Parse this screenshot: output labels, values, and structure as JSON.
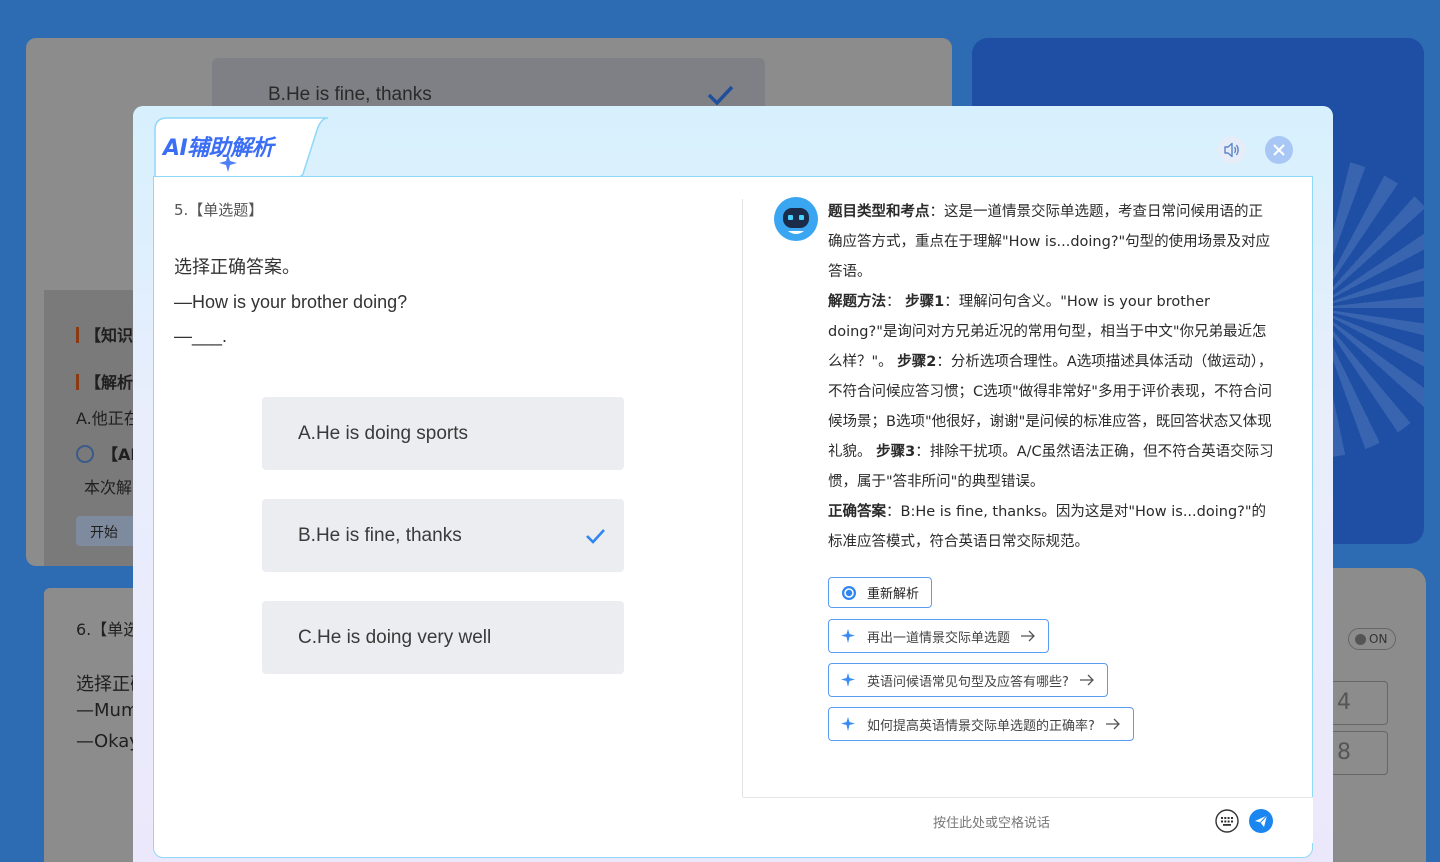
{
  "background": {
    "top_option_label": "B.He is fine, thanks",
    "section_knowledge": "【知识",
    "section_analysis": "【解析",
    "analysis_snippet": "A.他正在",
    "ai_fragment": "【AI",
    "explain_fragment": "本次解",
    "start_fragment": "开始",
    "q6_type": "6.【单选",
    "q6_line1": "选择正确",
    "q6_line2": "—Mum",
    "q6_line3": "—Okay",
    "toggle_label": "ON",
    "num_box_1": "4",
    "num_box_2": "8"
  },
  "modal": {
    "logo": "AI辅助解析",
    "sound_icon": "speaker-icon",
    "close_icon": "close-icon"
  },
  "question": {
    "type": "5.【单选题】",
    "instruction": "选择正确答案。",
    "prompt": "—How is your brother doing?",
    "blank": "—___.",
    "options": [
      {
        "label": "A.He is doing sports",
        "correct": false
      },
      {
        "label": "B.He is fine, thanks",
        "correct": true
      },
      {
        "label": "C.He is doing very well",
        "correct": false
      }
    ]
  },
  "analysis": {
    "p1_title": "题目类型和考点",
    "p1_text": "：这是一道情景交际单选题，考查日常问候用语的正确应答方式，重点在于理解\"How is...doing?\"句型的使用场景及对应答语。",
    "p2_title": "解题方法",
    "p2_sep": "：",
    "step1_title": "步骤1",
    "step1_text": "：理解问句含义。\"How is your brother doing?\"是询问对方兄弟近况的常用句型，相当于中文\"你兄弟最近怎么样？\"。",
    "step2_title": "步骤2",
    "step2_text": "：分析选项合理性。A选项描述具体活动（做运动），不符合问候应答习惯；C选项\"做得非常好\"多用于评价表现，不符合问候场景；B选项\"他很好，谢谢\"是问候的标准应答，既回答状态又体现礼貌。",
    "step3_title": "步骤3",
    "step3_text": "：排除干扰项。A/C虽然语法正确，但不符合英语交际习惯，属于\"答非所问\"的典型错误。",
    "p3_title": "正确答案",
    "p3_text": "：B:He is fine, thanks。因为这是对\"How is...doing?\"的标准应答模式，符合英语日常交际规范。"
  },
  "actions": {
    "reanalyze": "重新解析",
    "suggestions": [
      "再出一道情景交际单选题",
      "英语问候语常见句型及应答有哪些?",
      "如何提高英语情景交际单选题的正确率?"
    ]
  },
  "input": {
    "placeholder": "按住此处或空格说话"
  }
}
